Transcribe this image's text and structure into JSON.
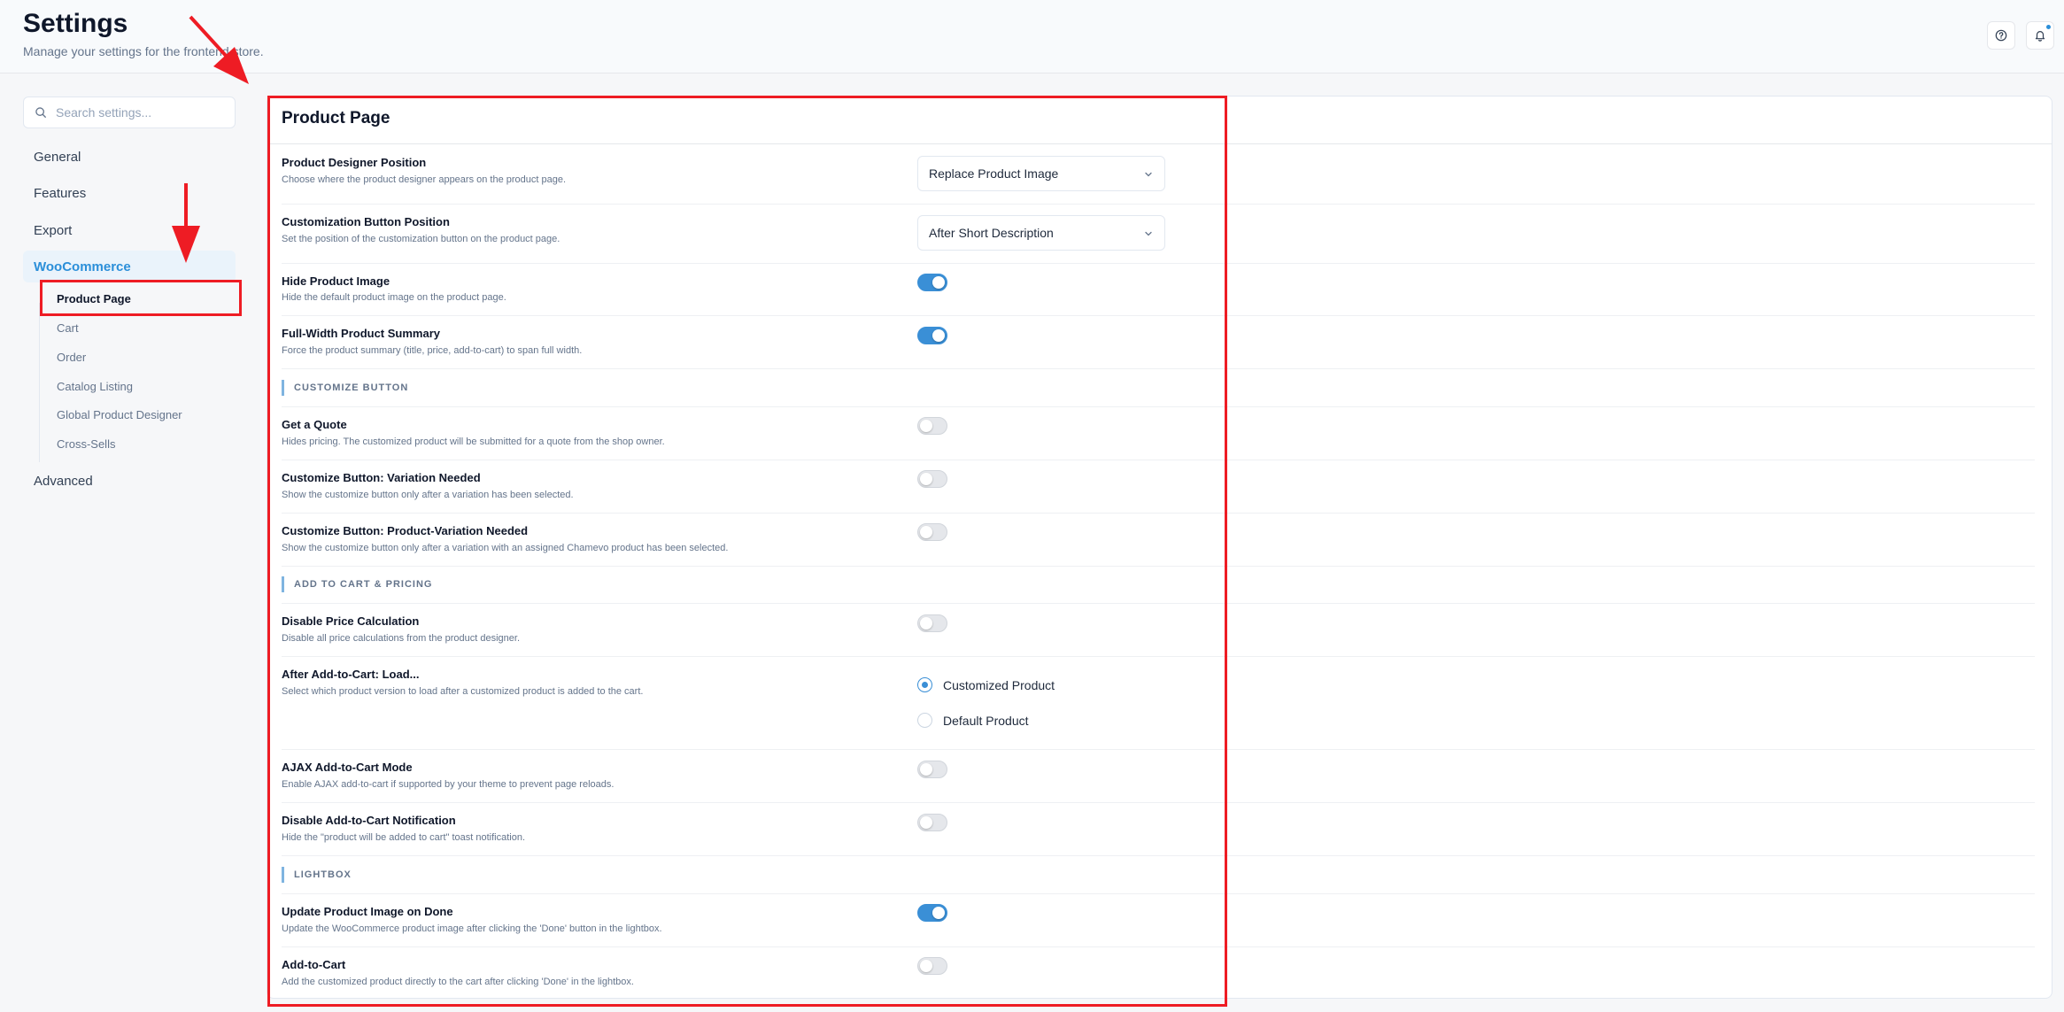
{
  "header": {
    "title": "Settings",
    "subtitle": "Manage your settings for the frontend store.",
    "help_icon": "help-circle-icon",
    "bell_icon": "bell-icon"
  },
  "sidebar": {
    "search_placeholder": "Search settings...",
    "items": [
      {
        "label": "General"
      },
      {
        "label": "Features"
      },
      {
        "label": "Export"
      },
      {
        "label": "WooCommerce",
        "active": true
      },
      {
        "label": "Advanced"
      }
    ],
    "woocommerce_subitems": [
      {
        "label": "Product Page",
        "active": true
      },
      {
        "label": "Cart"
      },
      {
        "label": "Order"
      },
      {
        "label": "Catalog Listing"
      },
      {
        "label": "Global Product Designer"
      },
      {
        "label": "Cross-Sells"
      }
    ]
  },
  "panel": {
    "title": "Product Page",
    "rows": [
      {
        "label": "Product Designer Position",
        "desc": "Choose where the product designer appears on the product page.",
        "control": "select",
        "value": "Replace Product Image"
      },
      {
        "label": "Customization Button Position",
        "desc": "Set the position of the customization button on the product page.",
        "control": "select",
        "value": "After Short Description"
      },
      {
        "label": "Hide Product Image",
        "desc": "Hide the default product image on the product page.",
        "control": "toggle",
        "on": true
      },
      {
        "label": "Full-Width Product Summary",
        "desc": "Force the product summary (title, price, add-to-cart) to span full width.",
        "control": "toggle",
        "on": true
      }
    ],
    "sections": [
      {
        "title": "CUSTOMIZE BUTTON",
        "rows": [
          {
            "label": "Get a Quote",
            "desc": "Hides pricing. The customized product will be submitted for a quote from the shop owner.",
            "on": false
          },
          {
            "label": "Customize Button: Variation Needed",
            "desc": "Show the customize button only after a variation has been selected.",
            "on": false
          },
          {
            "label": "Customize Button: Product-Variation Needed",
            "desc": "Show the customize button only after a variation with an assigned Chamevo product has been selected.",
            "on": false
          }
        ]
      },
      {
        "title": "ADD TO CART & PRICING",
        "rows": [
          {
            "label": "Disable Price Calculation",
            "desc": "Disable all price calculations from the product designer.",
            "on": false
          },
          {
            "label": "After Add-to-Cart: Load...",
            "desc": "Select which product version to load after a customized product is added to the cart.",
            "control": "radio",
            "options": [
              "Customized Product",
              "Default Product"
            ],
            "selected": "Customized Product"
          },
          {
            "label": "AJAX Add-to-Cart Mode",
            "desc": "Enable AJAX add-to-cart if supported by your theme to prevent page reloads.",
            "on": false
          },
          {
            "label": "Disable Add-to-Cart Notification",
            "desc": "Hide the \"product will be added to cart\" toast notification.",
            "on": false
          }
        ]
      },
      {
        "title": "LIGHTBOX",
        "rows": [
          {
            "label": "Update Product Image on Done",
            "desc": "Update the WooCommerce product image after clicking the 'Done' button in the lightbox.",
            "on": true
          },
          {
            "label": "Add-to-Cart",
            "desc": "Add the customized product directly to the cart after clicking 'Done' in the lightbox.",
            "on": false
          }
        ]
      }
    ]
  },
  "colors": {
    "accent": "#3a8fd6",
    "annotation_red": "#ee1c24"
  }
}
